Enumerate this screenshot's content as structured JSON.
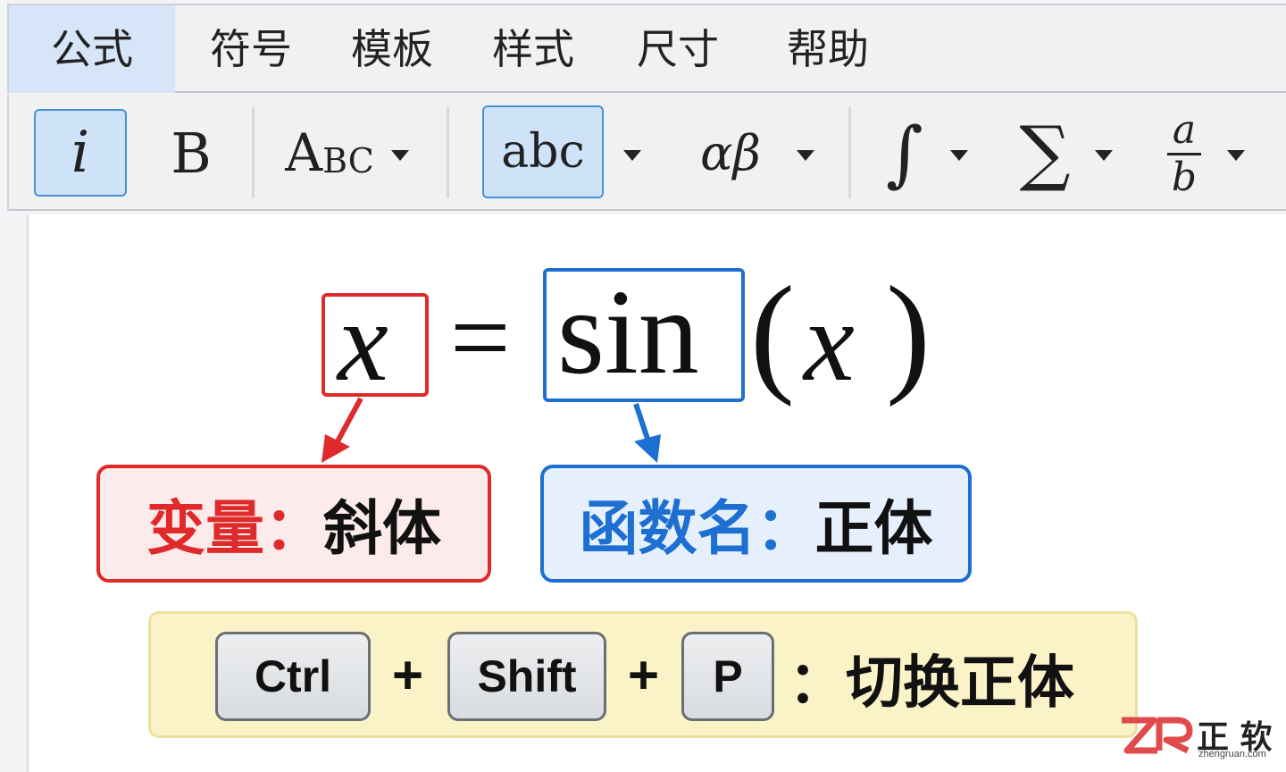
{
  "menubar": {
    "items": [
      "公式",
      "符号",
      "模板",
      "样式",
      "尺寸",
      "帮助"
    ],
    "active_index": 0
  },
  "toolbar": {
    "italic_label": "i",
    "bold_label": "B",
    "case_label_big": "A",
    "case_label_small": "BC",
    "text_style_label": "abc",
    "greek_label": "αβ",
    "integral_label": "∫",
    "sum_label": "∑",
    "fraction_num": "a",
    "fraction_den": "b"
  },
  "equation": {
    "var": "x",
    "equals": "=",
    "func": "sin",
    "open_paren": "(",
    "arg": "x",
    "close_paren": ")"
  },
  "labels": {
    "variable_prefix": "变量：",
    "variable_style": "斜体",
    "function_prefix": "函数名：",
    "function_style": "正体"
  },
  "shortcut": {
    "key1": "Ctrl",
    "key2": "Shift",
    "key3": "P",
    "plus": "+",
    "description": "：切换正体"
  },
  "watermark": {
    "brand_cn": "正 软",
    "domain": "zhengruan.com"
  },
  "colors": {
    "red": "#de2a2a",
    "blue": "#1d6fd1",
    "highlight": "#cfe3f8",
    "shortcut_bg": "#fbf3c8"
  }
}
